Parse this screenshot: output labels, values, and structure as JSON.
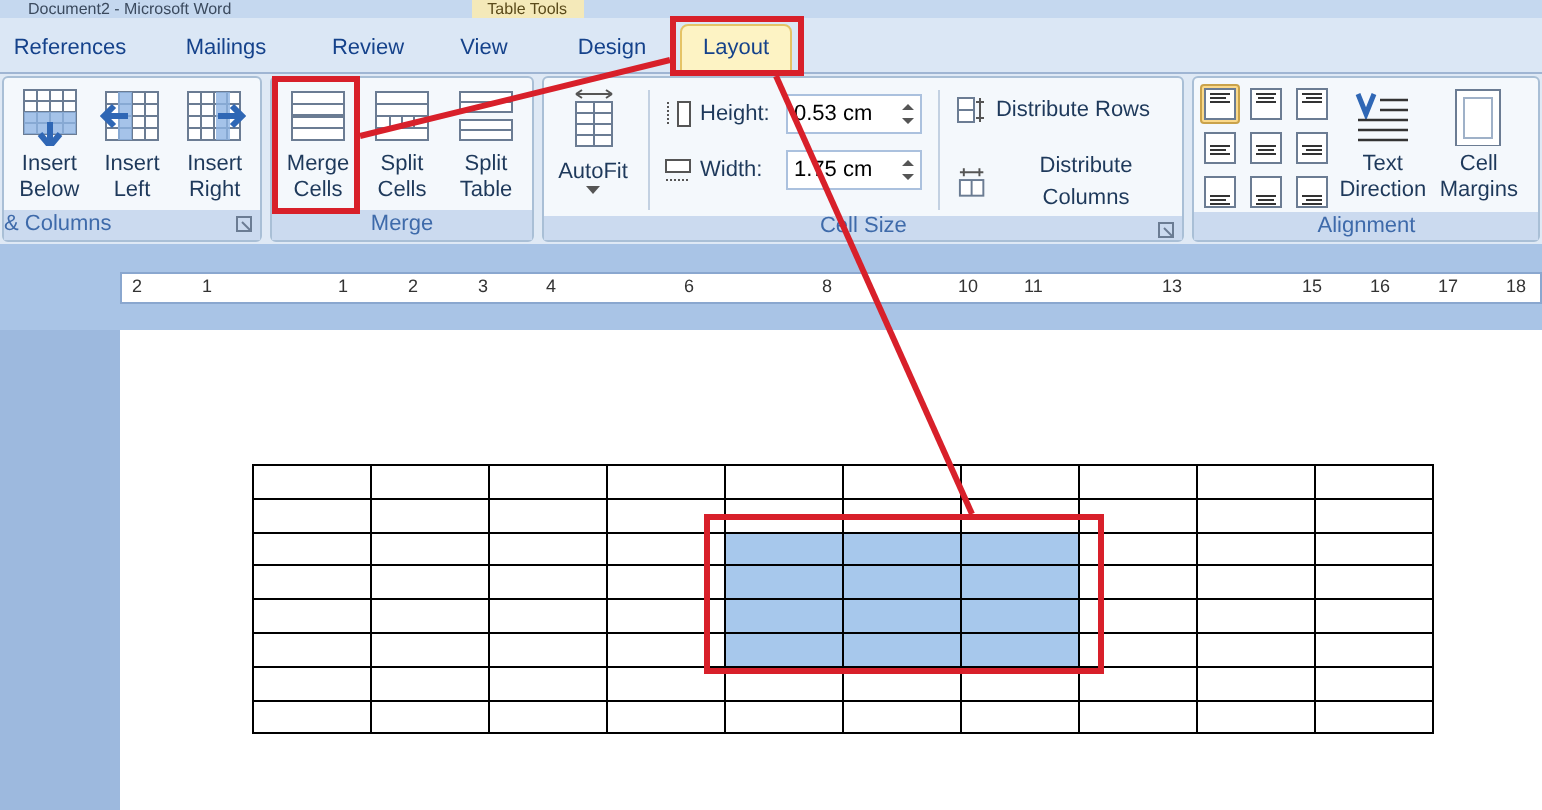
{
  "window": {
    "title": "Document2 - Microsoft Word",
    "context_title": "Table Tools"
  },
  "tabs": [
    {
      "label": "References",
      "selected": false
    },
    {
      "label": "Mailings",
      "selected": false
    },
    {
      "label": "Review",
      "selected": false
    },
    {
      "label": "View",
      "selected": false
    },
    {
      "label": "Design",
      "selected": false
    },
    {
      "label": "Layout",
      "selected": true
    }
  ],
  "ribbon": {
    "groups": [
      {
        "label": "& Columns",
        "buttons": [
          {
            "label": "Insert Below",
            "kind": "insert-below"
          },
          {
            "label": "Insert Left",
            "kind": "insert-left"
          },
          {
            "label": "Insert Right",
            "kind": "insert-right"
          }
        ]
      },
      {
        "label": "Merge",
        "buttons": [
          {
            "label": "Merge Cells",
            "kind": "merge"
          },
          {
            "label": "Split Cells",
            "kind": "split-cells"
          },
          {
            "label": "Split Table",
            "kind": "split-table"
          }
        ]
      },
      {
        "label": "Cell Size",
        "autofit": {
          "label": "AutoFit"
        },
        "fields": [
          {
            "label": "Height:",
            "value": "0.53 cm"
          },
          {
            "label": "Width:",
            "value": "1.75 cm"
          }
        ],
        "distribute": [
          {
            "label": "Distribute Rows",
            "kind": "rows"
          },
          {
            "label": "Distribute Columns",
            "kind": "columns"
          }
        ]
      },
      {
        "label": "Alignment",
        "align_buttons": [
          {
            "selected": true
          },
          {
            "selected": false
          },
          {
            "selected": false
          },
          {
            "selected": false
          },
          {
            "selected": false
          },
          {
            "selected": false
          },
          {
            "selected": false
          },
          {
            "selected": false
          },
          {
            "selected": false
          }
        ],
        "buttons": [
          {
            "label": "Text Direction",
            "kind": "text-direction"
          },
          {
            "label": "Cell Margins",
            "kind": "cell-margins"
          }
        ]
      }
    ]
  },
  "ruler": {
    "labels": [
      "2",
      "1",
      "1",
      "2",
      "3",
      "4",
      "6",
      "8",
      "10",
      "11",
      "13",
      "15",
      "16",
      "17",
      "18"
    ]
  },
  "table": {
    "rows": [
      {
        "cells": [
          {
            "selected": false
          },
          {
            "selected": false
          },
          {
            "selected": false
          },
          {
            "selected": false
          },
          {
            "selected": false
          },
          {
            "selected": false
          },
          {
            "selected": false
          },
          {
            "selected": false
          },
          {
            "selected": false
          },
          {
            "selected": false
          }
        ]
      },
      {
        "cells": [
          {
            "selected": false
          },
          {
            "selected": false
          },
          {
            "selected": false
          },
          {
            "selected": false
          },
          {
            "selected": false
          },
          {
            "selected": false
          },
          {
            "selected": false
          },
          {
            "selected": false
          },
          {
            "selected": false
          },
          {
            "selected": false
          }
        ]
      },
      {
        "cells": [
          {
            "selected": false
          },
          {
            "selected": false
          },
          {
            "selected": false
          },
          {
            "selected": false
          },
          {
            "selected": true
          },
          {
            "selected": true
          },
          {
            "selected": true
          },
          {
            "selected": false
          },
          {
            "selected": false
          },
          {
            "selected": false
          }
        ]
      },
      {
        "cells": [
          {
            "selected": false
          },
          {
            "selected": false
          },
          {
            "selected": false
          },
          {
            "selected": false
          },
          {
            "selected": true
          },
          {
            "selected": true
          },
          {
            "selected": true
          },
          {
            "selected": false
          },
          {
            "selected": false
          },
          {
            "selected": false
          }
        ]
      },
      {
        "cells": [
          {
            "selected": false
          },
          {
            "selected": false
          },
          {
            "selected": false
          },
          {
            "selected": false
          },
          {
            "selected": true
          },
          {
            "selected": true
          },
          {
            "selected": true
          },
          {
            "selected": false
          },
          {
            "selected": false
          },
          {
            "selected": false
          }
        ]
      },
      {
        "cells": [
          {
            "selected": false
          },
          {
            "selected": false
          },
          {
            "selected": false
          },
          {
            "selected": false
          },
          {
            "selected": true
          },
          {
            "selected": true
          },
          {
            "selected": true
          },
          {
            "selected": false
          },
          {
            "selected": false
          },
          {
            "selected": false
          }
        ]
      },
      {
        "cells": [
          {
            "selected": false
          },
          {
            "selected": false
          },
          {
            "selected": false
          },
          {
            "selected": false
          },
          {
            "selected": false
          },
          {
            "selected": false
          },
          {
            "selected": false
          },
          {
            "selected": false
          },
          {
            "selected": false
          },
          {
            "selected": false
          }
        ]
      },
      {
        "cells": [
          {
            "selected": false
          },
          {
            "selected": false
          },
          {
            "selected": false
          },
          {
            "selected": false
          },
          {
            "selected": false
          },
          {
            "selected": false
          },
          {
            "selected": false
          },
          {
            "selected": false
          },
          {
            "selected": false
          },
          {
            "selected": false
          }
        ]
      }
    ]
  }
}
